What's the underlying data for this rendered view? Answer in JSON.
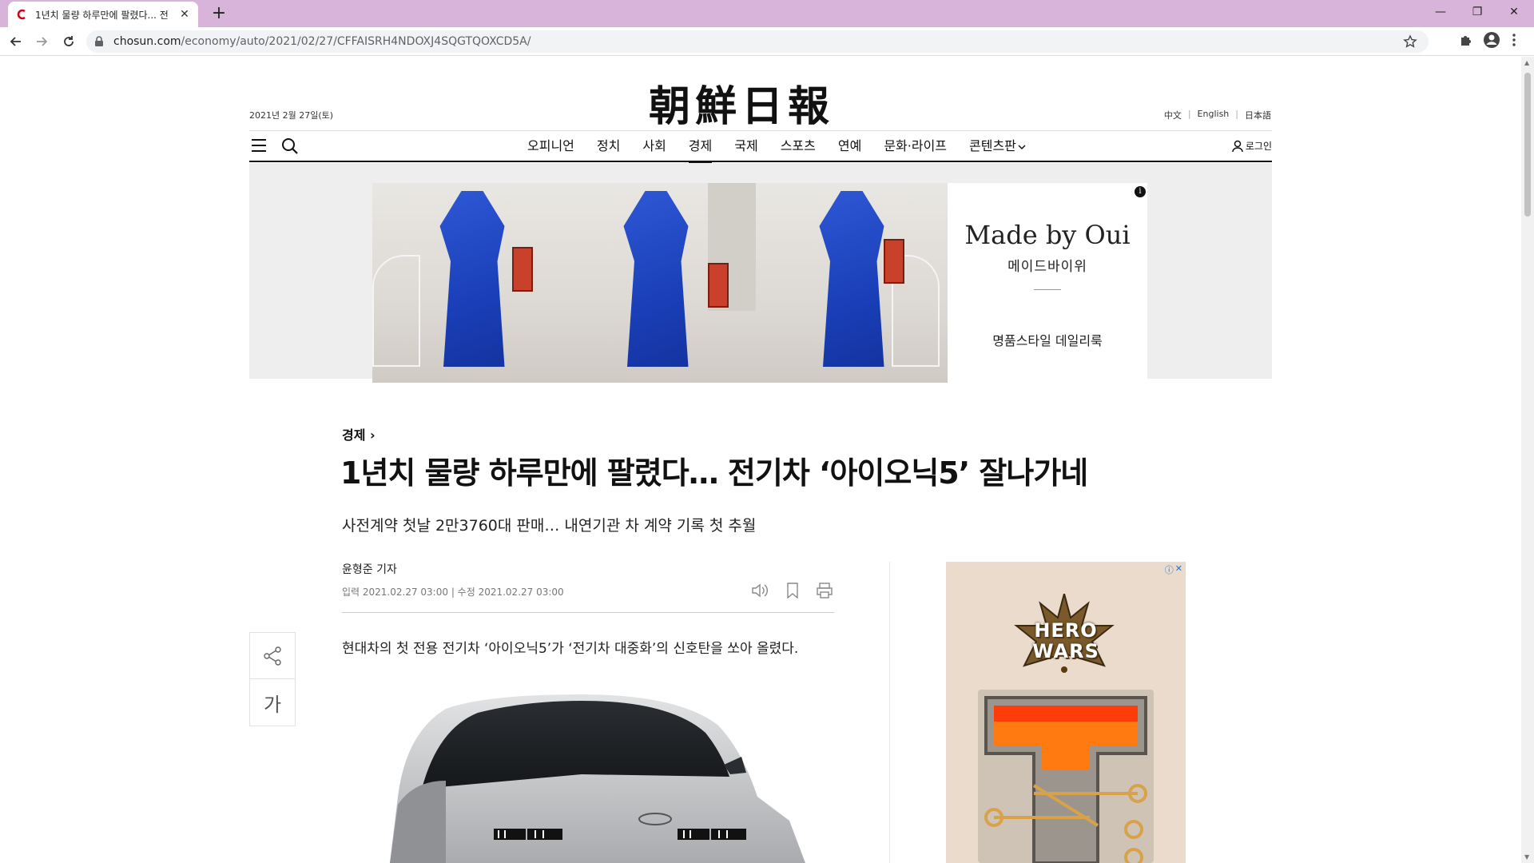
{
  "browser": {
    "tab_title": "1년치 물량 하루만에 팔렸다... 전",
    "url_host": "chosun.com",
    "url_path": "/economy/auto/2021/02/27/CFFAISRH4NDOXJ4SQGTQOXCD5A/",
    "accent": "#d9b4da"
  },
  "header": {
    "logo": "朝鮮日報",
    "date": "2021년 2월 27일(토)",
    "languages": [
      "中文",
      "English",
      "日本語"
    ],
    "login_label": "로그인"
  },
  "nav": {
    "items": [
      "오피니언",
      "정치",
      "사회",
      "경제",
      "국제",
      "스포츠",
      "연예",
      "문화·라이프",
      "콘텐츠판"
    ],
    "active": "경제"
  },
  "ad_top": {
    "brand": "Made by Oui",
    "brand_korean": "메이드바이위",
    "copy": "명품스타일 데일리룩"
  },
  "article": {
    "section": "경제",
    "section_arrow": "›",
    "headline": "1년치 물량 하루만에 팔렸다… 전기차 ‘아이오닉5’ 잘나가네",
    "subheadline": "사전계약 첫날 2만3760대 판매… 내연기관 차 계약 기록 첫 추월",
    "byline": "윤형준 기자",
    "dates": "입력 2021.02.27 03:00 | 수정 2021.02.27 03:00",
    "lead": "현대차의 첫 전용 전기차 ‘아이오닉5’가 ‘전기차 대중화’의 신호탄을 쏘아 올렸다.",
    "font_size_label": "가"
  },
  "ad_right": {
    "game_line1": "HERO",
    "game_line2": "WARS"
  }
}
